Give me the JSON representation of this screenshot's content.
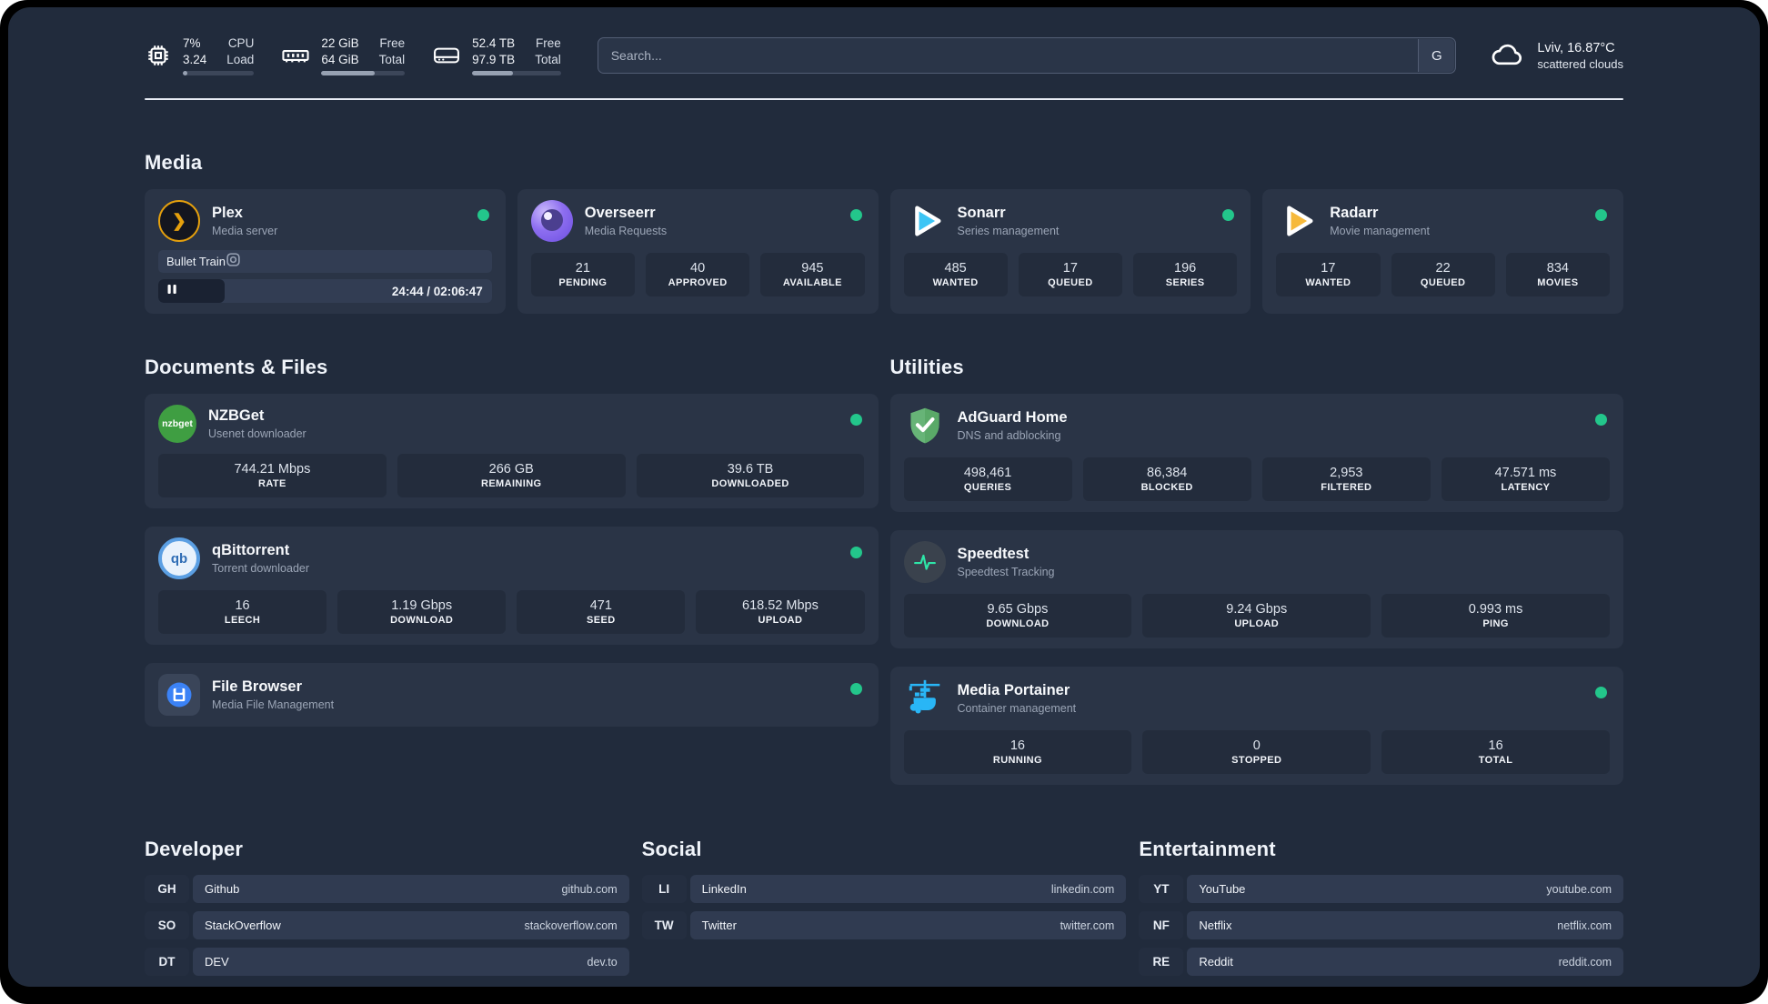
{
  "colors": {
    "status_online": "#23c68b",
    "plex_amber": "#e5a00d",
    "sonarr_blue": "#3cc5f5",
    "radarr_orange": "#f6b93b",
    "accent_green": "#2ee6a8",
    "portainer_blue": "#29b6f6"
  },
  "header": {
    "stats": [
      {
        "icon": "cpu-icon",
        "value_top": "7%",
        "value_bottom": "3.24",
        "label_top": "CPU",
        "label_bottom": "Load",
        "progress_pct": 7
      },
      {
        "icon": "ram-icon",
        "value_top": "22 GiB",
        "value_bottom": "64 GiB",
        "label_top": "Free",
        "label_bottom": "Total",
        "progress_pct": 64
      },
      {
        "icon": "disk-icon",
        "value_top": "52.4 TB",
        "value_bottom": "97.9 TB",
        "label_top": "Free",
        "label_bottom": "Total",
        "progress_pct": 46
      }
    ],
    "search": {
      "placeholder": "Search...",
      "button_label": "G"
    },
    "weather": {
      "icon": "cloud-icon",
      "location": "Lviv, 16.87°C",
      "condition": "scattered clouds"
    }
  },
  "media": {
    "title": "Media",
    "plex": {
      "name": "Plex",
      "desc": "Media server",
      "icon": "plex-icon",
      "now_playing": "Bullet Train",
      "time": "24:44 / 02:06:47",
      "progress_pct": 20
    },
    "apps": [
      {
        "name": "Overseerr",
        "desc": "Media Requests",
        "icon": "overseerr-icon",
        "stats": [
          {
            "value": "21",
            "label": "PENDING"
          },
          {
            "value": "40",
            "label": "APPROVED"
          },
          {
            "value": "945",
            "label": "AVAILABLE"
          }
        ]
      },
      {
        "name": "Sonarr",
        "desc": "Series management",
        "icon": "sonarr-icon",
        "stats": [
          {
            "value": "485",
            "label": "WANTED"
          },
          {
            "value": "17",
            "label": "QUEUED"
          },
          {
            "value": "196",
            "label": "SERIES"
          }
        ]
      },
      {
        "name": "Radarr",
        "desc": "Movie management",
        "icon": "radarr-icon",
        "stats": [
          {
            "value": "17",
            "label": "WANTED"
          },
          {
            "value": "22",
            "label": "QUEUED"
          },
          {
            "value": "834",
            "label": "MOVIES"
          }
        ]
      }
    ]
  },
  "documents": {
    "title": "Documents & Files",
    "apps": [
      {
        "name": "NZBGet",
        "desc": "Usenet downloader",
        "icon": "nzbget-icon",
        "icon_text": "nzbget",
        "stats": [
          {
            "value": "744.21 Mbps",
            "label": "RATE"
          },
          {
            "value": "266 GB",
            "label": "REMAINING"
          },
          {
            "value": "39.6 TB",
            "label": "DOWNLOADED"
          }
        ]
      },
      {
        "name": "qBittorrent",
        "desc": "Torrent downloader",
        "icon": "qbittorrent-icon",
        "icon_text": "qb",
        "stats": [
          {
            "value": "16",
            "label": "LEECH"
          },
          {
            "value": "1.19 Gbps",
            "label": "DOWNLOAD"
          },
          {
            "value": "471",
            "label": "SEED"
          },
          {
            "value": "618.52 Mbps",
            "label": "UPLOAD"
          }
        ]
      },
      {
        "name": "File Browser",
        "desc": "Media File Management",
        "icon": "filebrowser-icon",
        "stats": []
      }
    ]
  },
  "utilities": {
    "title": "Utilities",
    "apps": [
      {
        "name": "AdGuard Home",
        "desc": "DNS and adblocking",
        "icon": "adguard-icon",
        "stats": [
          {
            "value": "498,461",
            "label": "QUERIES"
          },
          {
            "value": "86,384",
            "label": "BLOCKED"
          },
          {
            "value": "2,953",
            "label": "FILTERED"
          },
          {
            "value": "47.571 ms",
            "label": "LATENCY"
          }
        ]
      },
      {
        "name": "Speedtest",
        "desc": "Speedtest Tracking",
        "icon": "speedtest-icon",
        "stats": [
          {
            "value": "9.65 Gbps",
            "label": "DOWNLOAD"
          },
          {
            "value": "9.24 Gbps",
            "label": "UPLOAD"
          },
          {
            "value": "0.993 ms",
            "label": "PING"
          }
        ]
      },
      {
        "name": "Media Portainer",
        "desc": "Container management",
        "icon": "portainer-icon",
        "stats": [
          {
            "value": "16",
            "label": "RUNNING"
          },
          {
            "value": "0",
            "label": "STOPPED"
          },
          {
            "value": "16",
            "label": "TOTAL"
          }
        ]
      }
    ]
  },
  "links": {
    "developer": {
      "title": "Developer",
      "items": [
        {
          "abbr": "GH",
          "name": "Github",
          "url": "github.com"
        },
        {
          "abbr": "SO",
          "name": "StackOverflow",
          "url": "stackoverflow.com"
        },
        {
          "abbr": "DT",
          "name": "DEV",
          "url": "dev.to"
        }
      ]
    },
    "social": {
      "title": "Social",
      "items": [
        {
          "abbr": "LI",
          "name": "LinkedIn",
          "url": "linkedin.com"
        },
        {
          "abbr": "TW",
          "name": "Twitter",
          "url": "twitter.com"
        }
      ]
    },
    "entertainment": {
      "title": "Entertainment",
      "items": [
        {
          "abbr": "YT",
          "name": "YouTube",
          "url": "youtube.com"
        },
        {
          "abbr": "NF",
          "name": "Netflix",
          "url": "netflix.com"
        },
        {
          "abbr": "RE",
          "name": "Reddit",
          "url": "reddit.com"
        }
      ]
    }
  }
}
